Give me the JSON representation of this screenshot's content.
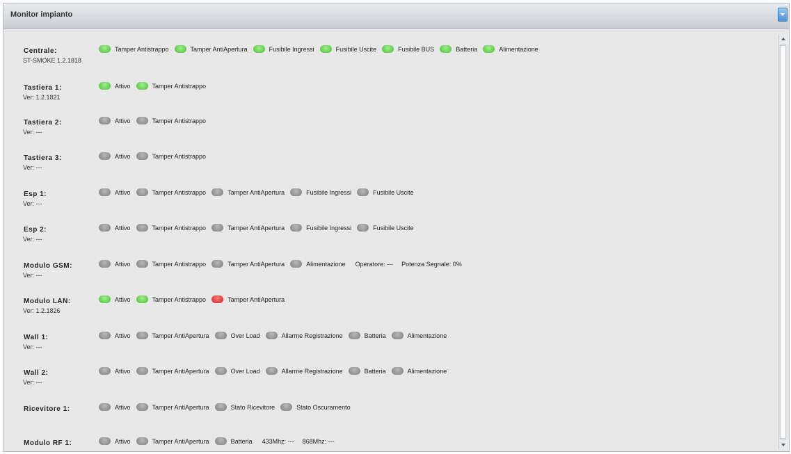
{
  "window": {
    "title": "Monitor impianto"
  },
  "rows": [
    {
      "name": "Centrale:",
      "version": "ST-SMOKE 1.2.1818",
      "items": [
        {
          "label": "Tamper Antistrappo",
          "state": "green"
        },
        {
          "label": "Tamper AntiApertura",
          "state": "green"
        },
        {
          "label": "Fusibile Ingressi",
          "state": "green"
        },
        {
          "label": "Fusibile Uscite",
          "state": "green"
        },
        {
          "label": "Fusibile BUS",
          "state": "green"
        },
        {
          "label": "Batteria",
          "state": "green"
        },
        {
          "label": "Alimentazione",
          "state": "green"
        }
      ],
      "extras": []
    },
    {
      "name": "Tastiera 1:",
      "version": "Ver: 1.2.1821",
      "items": [
        {
          "label": "Attivo",
          "state": "green"
        },
        {
          "label": "Tamper Antistrappo",
          "state": "green"
        }
      ],
      "extras": []
    },
    {
      "name": "Tastiera 2:",
      "version": "Ver: ---",
      "items": [
        {
          "label": "Attivo",
          "state": "gray"
        },
        {
          "label": "Tamper Antistrappo",
          "state": "gray"
        }
      ],
      "extras": []
    },
    {
      "name": "Tastiera 3:",
      "version": "Ver: ---",
      "items": [
        {
          "label": "Attivo",
          "state": "gray"
        },
        {
          "label": "Tamper Antistrappo",
          "state": "gray"
        }
      ],
      "extras": []
    },
    {
      "name": "Esp 1:",
      "version": "Ver: ---",
      "items": [
        {
          "label": "Attivo",
          "state": "gray"
        },
        {
          "label": "Tamper Antistrappo",
          "state": "gray"
        },
        {
          "label": "Tamper AntiApertura",
          "state": "gray"
        },
        {
          "label": "Fusibile Ingressi",
          "state": "gray"
        },
        {
          "label": "Fusibile Uscite",
          "state": "gray"
        }
      ],
      "extras": []
    },
    {
      "name": "Esp 2:",
      "version": "Ver: ---",
      "items": [
        {
          "label": "Attivo",
          "state": "gray"
        },
        {
          "label": "Tamper Antistrappo",
          "state": "gray"
        },
        {
          "label": "Tamper AntiApertura",
          "state": "gray"
        },
        {
          "label": "Fusibile Ingressi",
          "state": "gray"
        },
        {
          "label": "Fusibile Uscite",
          "state": "gray"
        }
      ],
      "extras": []
    },
    {
      "name": "Modulo GSM:",
      "version": "Ver: ---",
      "items": [
        {
          "label": "Attivo",
          "state": "gray"
        },
        {
          "label": "Tamper Antistrappo",
          "state": "gray"
        },
        {
          "label": "Tamper AntiApertura",
          "state": "gray"
        },
        {
          "label": "Alimentazione",
          "state": "gray"
        }
      ],
      "extras": [
        "Operatore: ---",
        "Potenza Segnale: 0%"
      ]
    },
    {
      "name": "Modulo LAN:",
      "version": "Ver: 1.2.1826",
      "items": [
        {
          "label": "Attivo",
          "state": "green"
        },
        {
          "label": "Tamper Antistrappo",
          "state": "green"
        },
        {
          "label": "Tamper AntiApertura",
          "state": "red"
        }
      ],
      "extras": []
    },
    {
      "name": "Wall 1:",
      "version": "Ver: ---",
      "items": [
        {
          "label": "Attivo",
          "state": "gray"
        },
        {
          "label": "Tamper AntiApertura",
          "state": "gray"
        },
        {
          "label": "Over Load",
          "state": "gray"
        },
        {
          "label": "Allarme Registrazione",
          "state": "gray"
        },
        {
          "label": "Batteria",
          "state": "gray"
        },
        {
          "label": "Alimentazione",
          "state": "gray"
        }
      ],
      "extras": []
    },
    {
      "name": "Wall 2:",
      "version": "Ver: ---",
      "items": [
        {
          "label": "Attivo",
          "state": "gray"
        },
        {
          "label": "Tamper AntiApertura",
          "state": "gray"
        },
        {
          "label": "Over Load",
          "state": "gray"
        },
        {
          "label": "Allarme Registrazione",
          "state": "gray"
        },
        {
          "label": "Batteria",
          "state": "gray"
        },
        {
          "label": "Alimentazione",
          "state": "gray"
        }
      ],
      "extras": []
    },
    {
      "name": "Ricevitore 1:",
      "version": "",
      "items": [
        {
          "label": "Attivo",
          "state": "gray"
        },
        {
          "label": "Tamper AntiApertura",
          "state": "gray"
        },
        {
          "label": "Stato Ricevitore",
          "state": "gray"
        },
        {
          "label": "Stato Oscuramento",
          "state": "gray"
        }
      ],
      "extras": []
    },
    {
      "name": "Modulo RF 1:",
      "version": "",
      "items": [
        {
          "label": "Attivo",
          "state": "gray"
        },
        {
          "label": "Tamper AntiApertura",
          "state": "gray"
        },
        {
          "label": "Batteria",
          "state": "gray"
        }
      ],
      "extras": [
        "433Mhz: ---",
        "868Mhz: ---"
      ]
    }
  ],
  "colors": {
    "green": "#5cc84a",
    "gray": "#8c8c8c",
    "red": "#d42121"
  }
}
